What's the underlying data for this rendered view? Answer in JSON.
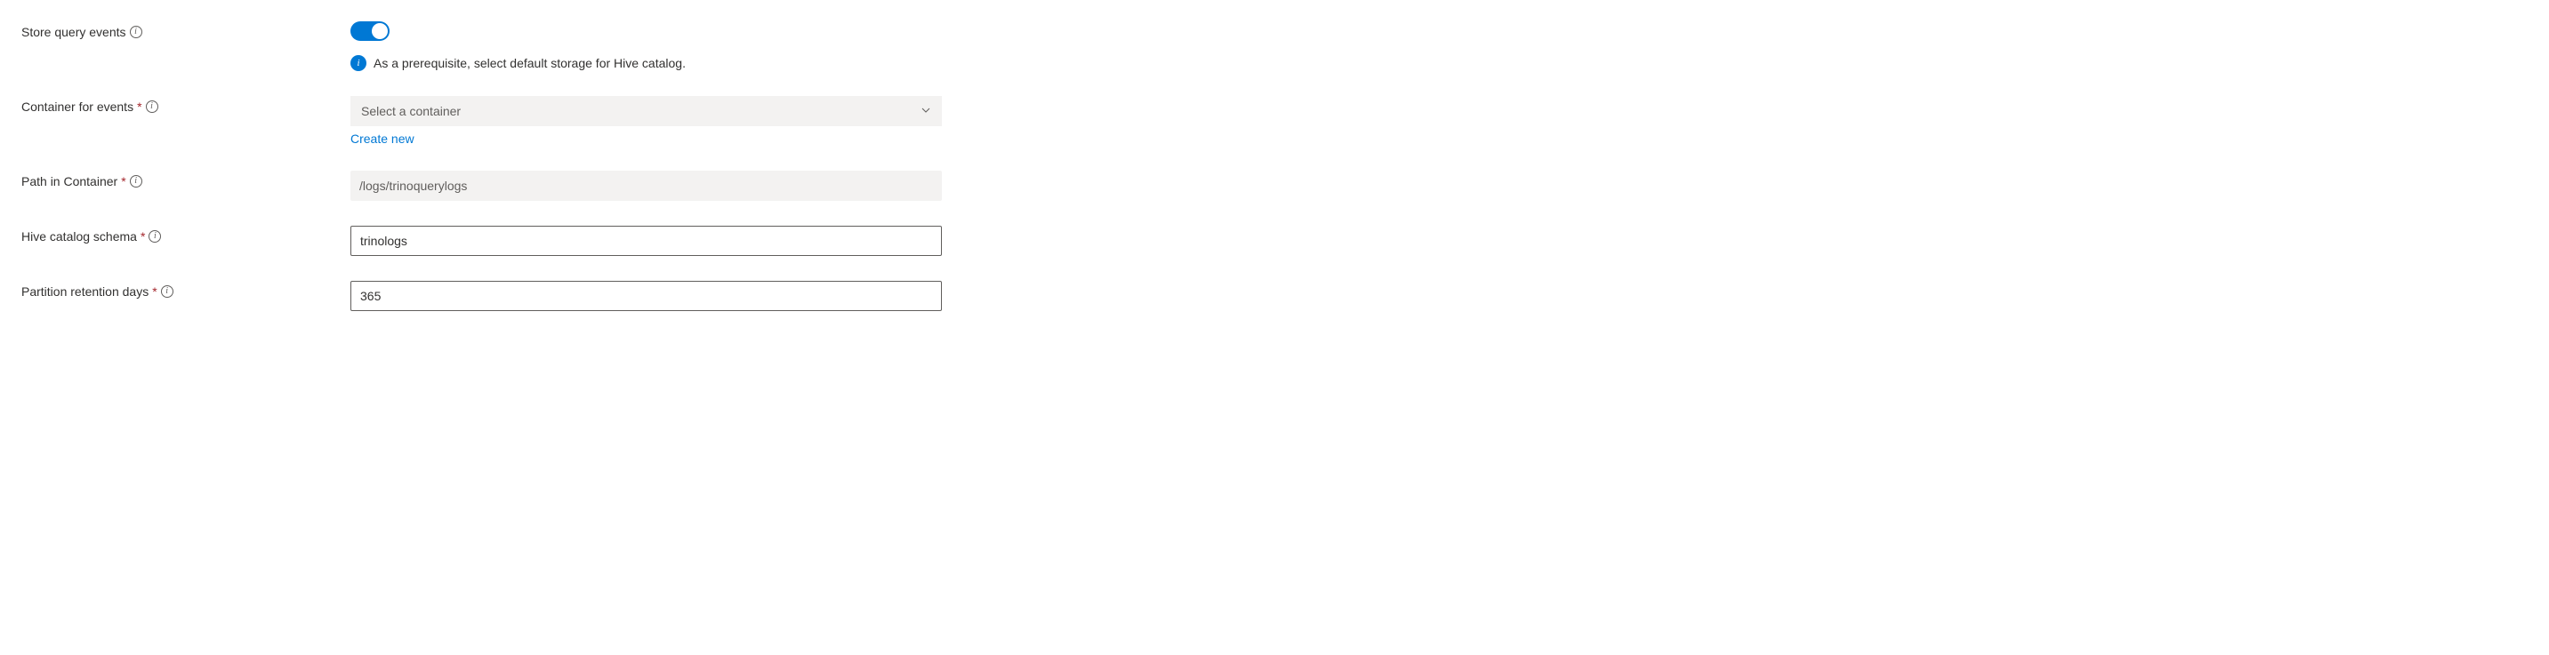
{
  "storeQueryEvents": {
    "label": "Store query events",
    "value": true,
    "infoText": "As a prerequisite, select default storage for Hive catalog."
  },
  "containerForEvents": {
    "label": "Container for events",
    "required": true,
    "placeholder": "Select a container",
    "value": "",
    "createNewLabel": "Create new"
  },
  "pathInContainer": {
    "label": "Path in Container",
    "required": true,
    "placeholder": "/logs/trinoquerylogs",
    "value": ""
  },
  "hiveCatalogSchema": {
    "label": "Hive catalog schema",
    "required": true,
    "value": "trinologs"
  },
  "partitionRetentionDays": {
    "label": "Partition retention days",
    "required": true,
    "value": "365"
  },
  "glyphs": {
    "requiredMark": "*",
    "infoI": "i"
  }
}
